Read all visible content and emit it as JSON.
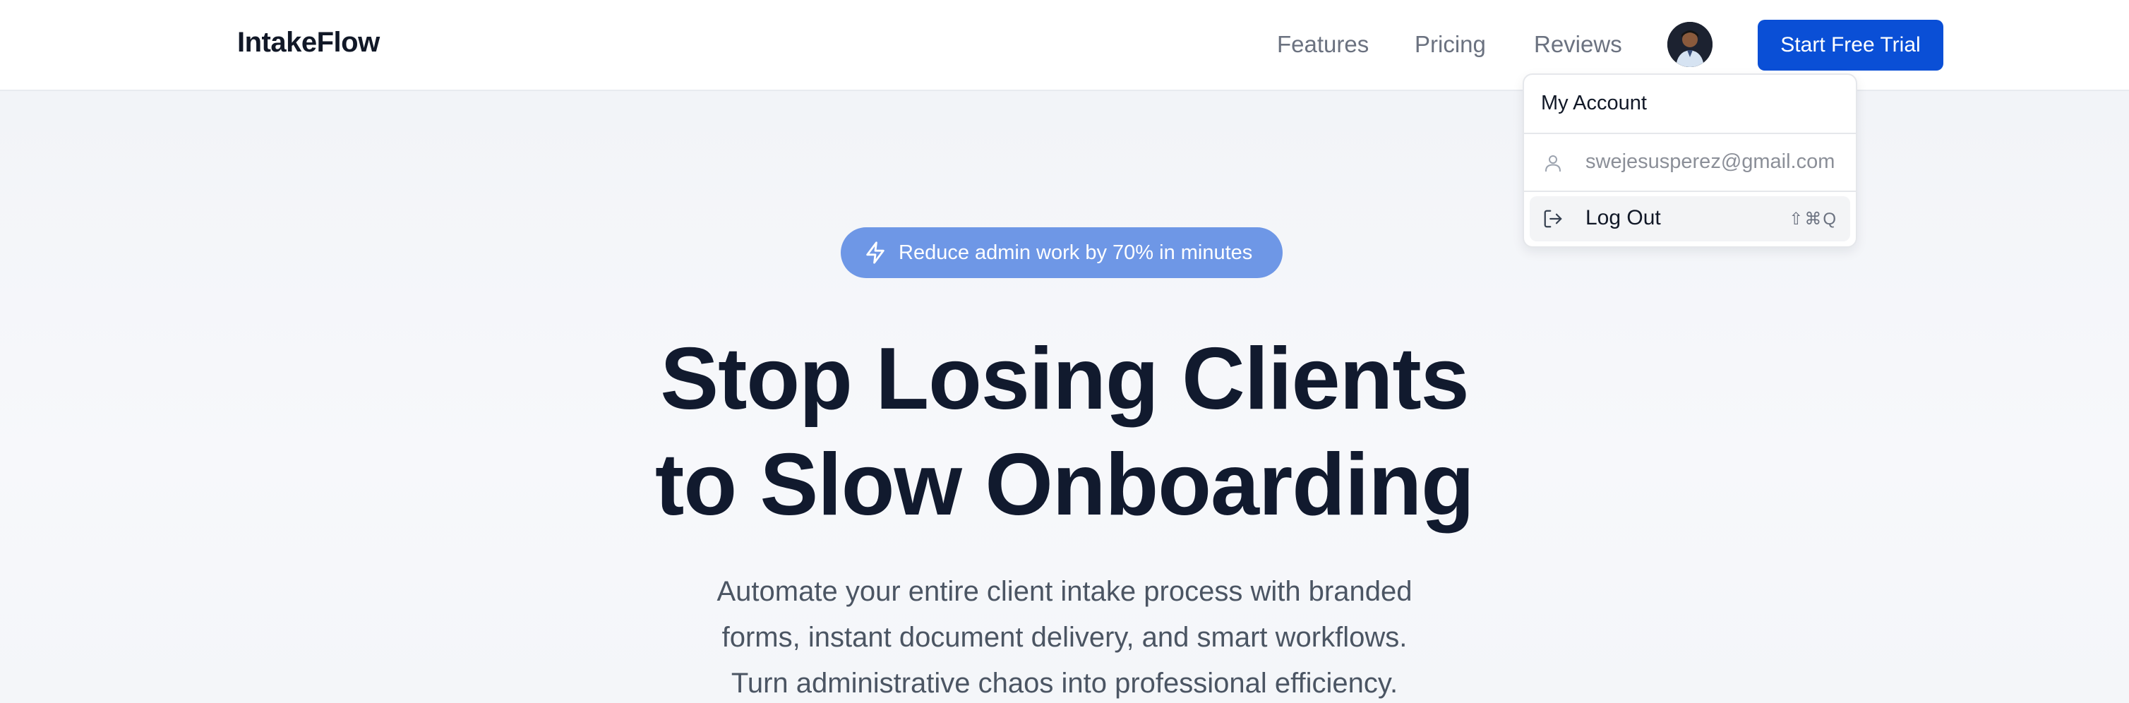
{
  "nav": {
    "brand": "IntakeFlow",
    "links": [
      "Features",
      "Pricing",
      "Reviews"
    ],
    "cta_label": "Start Free Trial",
    "avatar_icon": "user-avatar"
  },
  "hero": {
    "pill_icon": "lightning-icon",
    "pill_text": "Reduce admin work by 70% in minutes",
    "headline_line1": "Stop Losing Clients",
    "headline_line2": "to Slow Onboarding",
    "sub_line1": "Automate your entire client intake process with branded",
    "sub_line2": "forms, instant document delivery, and smart workflows.",
    "sub_line3": "Turn administrative chaos into professional efficiency."
  },
  "dropdown": {
    "header": "My Account",
    "email": "swejesusperez@gmail.com",
    "email_icon": "user-icon",
    "logout_label": "Log Out",
    "logout_icon": "log-out-icon",
    "logout_shortcut": "⇧⌘Q"
  },
  "colors": {
    "primary": "#0a4fd6",
    "pill": "#6e97e6",
    "heading": "#111a2e",
    "body": "#4b5563"
  }
}
